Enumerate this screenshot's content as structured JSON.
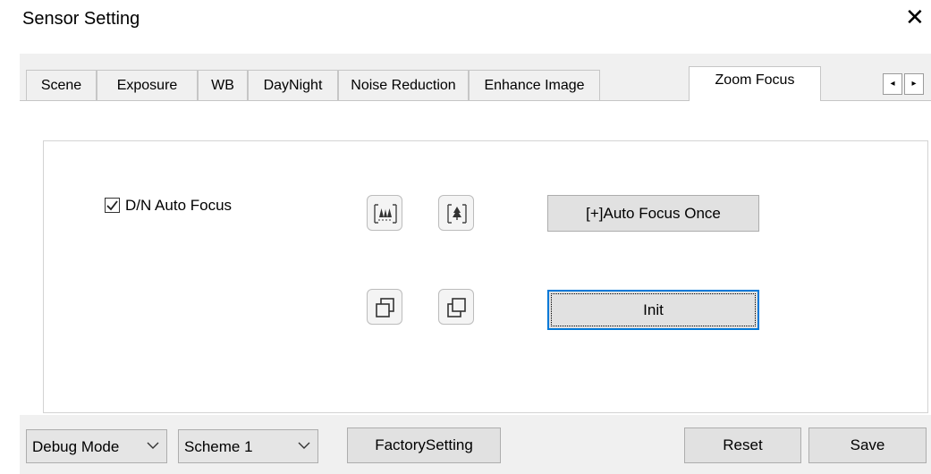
{
  "window": {
    "title": "Sensor Setting",
    "close_glyph": "✕"
  },
  "tabs": [
    {
      "label": "Scene"
    },
    {
      "label": "Exposure"
    },
    {
      "label": "WB"
    },
    {
      "label": "DayNight"
    },
    {
      "label": "Noise Reduction"
    },
    {
      "label": "Enhance Image"
    },
    {
      "label": "Zoom Focus",
      "active": true
    }
  ],
  "tab_scroll": {
    "left_glyph": "◂",
    "right_glyph": "▸"
  },
  "zoom_focus": {
    "dn_auto_focus": {
      "label": "D/N Auto Focus",
      "checked": true
    },
    "icons": [
      "zoom-wide-icon",
      "zoom-tele-icon",
      "focus-near-icon",
      "focus-far-icon"
    ],
    "auto_focus_once_label": "[+]Auto Focus Once",
    "init_label": "Init"
  },
  "footer": {
    "debug_mode_value": "Debug Mode",
    "scheme_value": "Scheme 1",
    "factory_label": "FactorySetting",
    "reset_label": "Reset",
    "save_label": "Save"
  }
}
